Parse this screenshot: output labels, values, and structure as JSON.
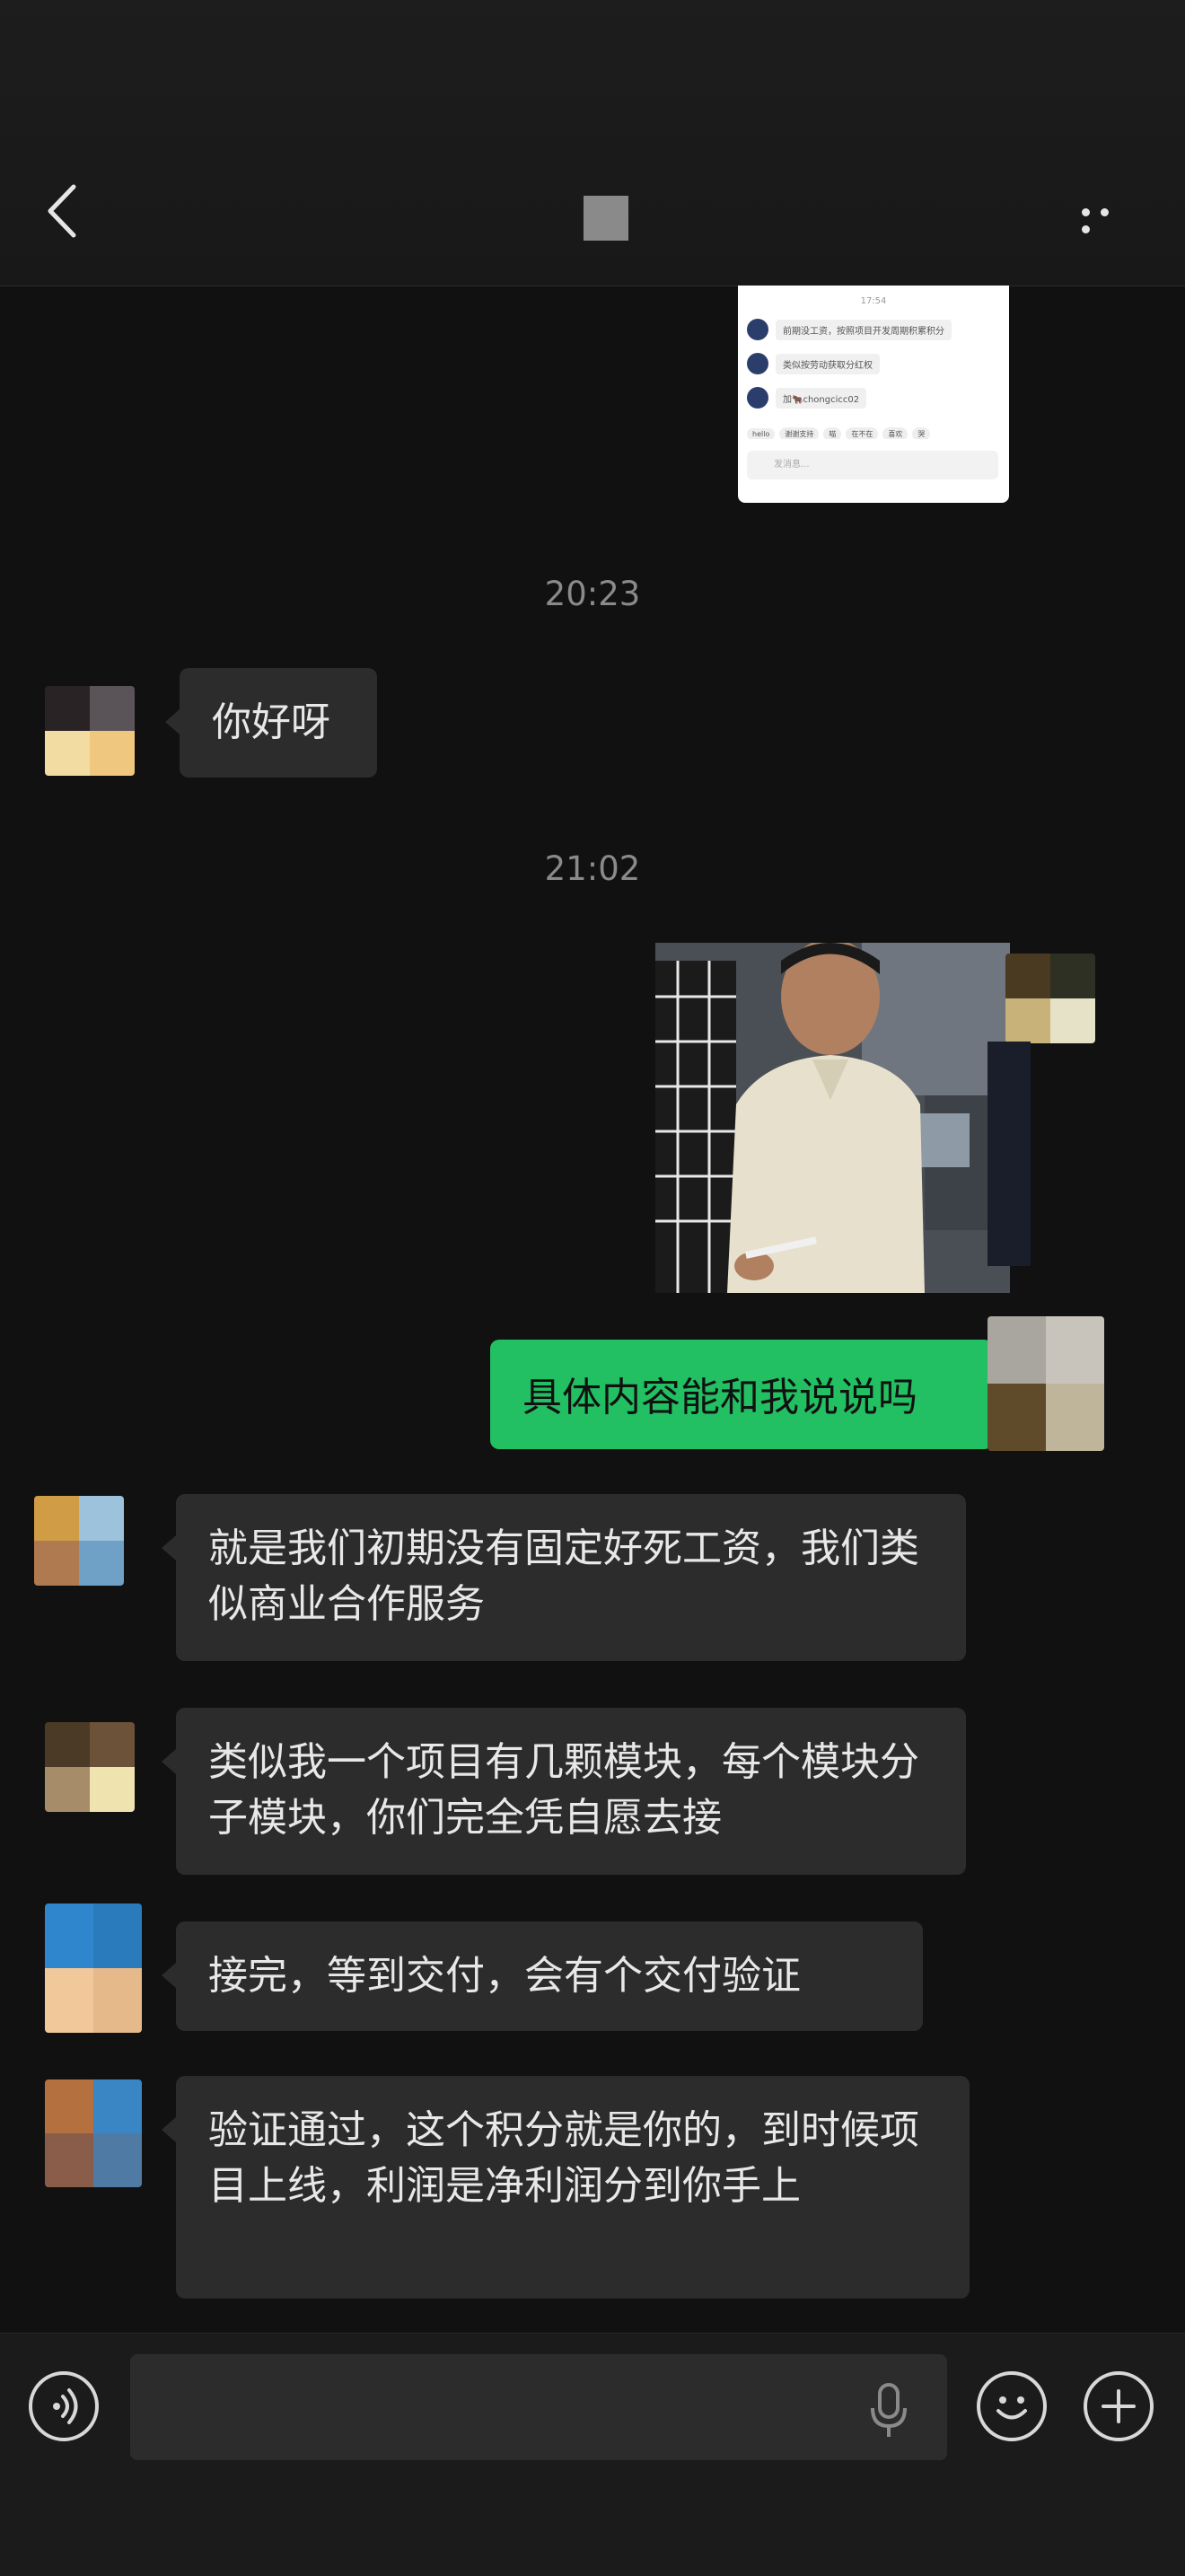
{
  "header": {
    "back_icon": "chevron-left-icon",
    "more_icon": "more-dots-icon"
  },
  "shared_card": {
    "time": "17:54",
    "rows": [
      "前期没工资，按照项目开发周期积累积分",
      "类似按劳动获取分红权",
      "加🐂chongcicc02"
    ],
    "chips": [
      "hello",
      "谢谢支持",
      "喵",
      "在不在",
      "喜欢",
      "哭"
    ],
    "input_placeholder": "发消息..."
  },
  "timestamps": {
    "t1": "20:23",
    "t2": "21:02"
  },
  "messages": [
    {
      "side": "in",
      "text": "你好呀"
    },
    {
      "side": "out",
      "type": "image"
    },
    {
      "side": "out",
      "text": "具体内容能和我说说吗"
    },
    {
      "side": "in",
      "text": "就是我们初期没有固定好死工资，我们类似商业合作服务"
    },
    {
      "side": "in",
      "text": "类似我一个项目有几颗模块，每个模块分子模块，你们完全凭自愿去接"
    },
    {
      "side": "in",
      "text": "接完，等到交付，会有个交付验证"
    },
    {
      "side": "in",
      "text": "验证通过，这个积分就是你的，到时候项目上线，利润是净利润分到你手上"
    }
  ],
  "bottom_bar": {
    "voice_icon": "voice-icon",
    "emoji_icon": "emoji-icon",
    "plus_icon": "plus-icon",
    "mic_icon": "mic-icon",
    "input_value": ""
  },
  "colors": {
    "background": "#111111",
    "bubble_in": "#2c2c2c",
    "bubble_out": "#22c063",
    "timestamp": "#8a8a8a"
  }
}
